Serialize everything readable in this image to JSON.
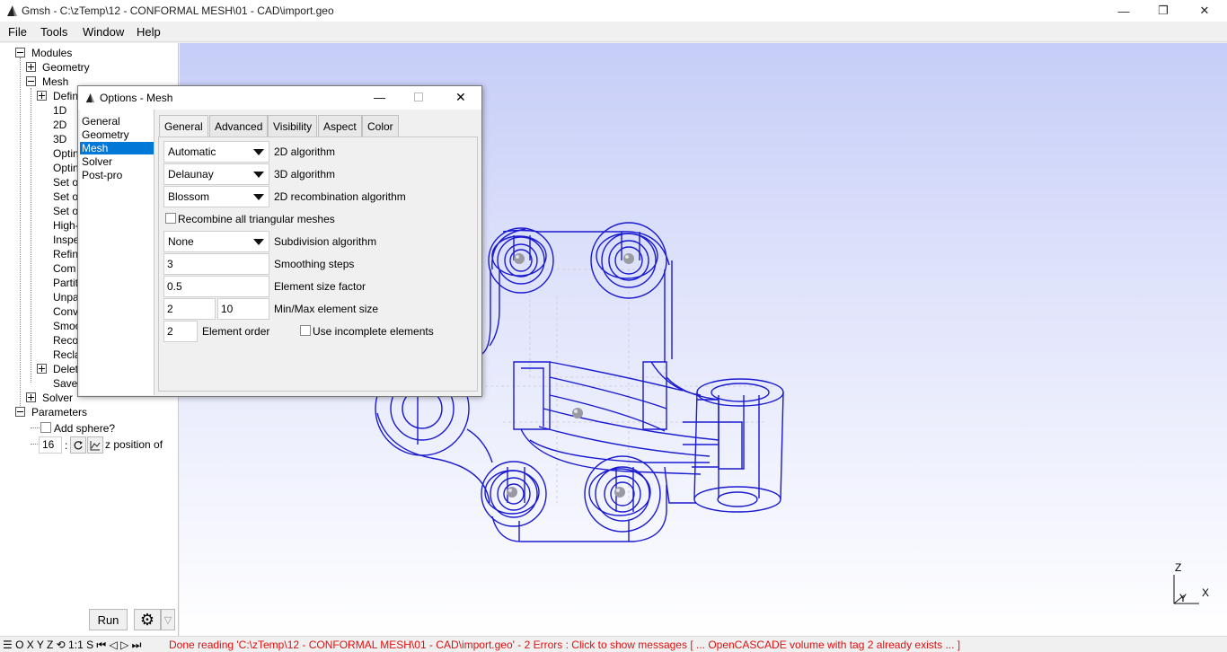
{
  "window": {
    "title": "Gmsh - C:\\zTemp\\12 - CONFORMAL MESH\\01 - CAD\\import.geo",
    "minimize": "—",
    "maximize": "❐",
    "close": "✕"
  },
  "menu": [
    "File",
    "Tools",
    "Window",
    "Help"
  ],
  "tree": {
    "modules": "Modules",
    "geometry": "Geometry",
    "mesh": "Mesh",
    "mesh_items": [
      "Defin",
      "1D",
      "2D",
      "3D",
      "Optin",
      "Optin",
      "Set o",
      "Set o",
      "Set o",
      "High-",
      "Inspe",
      "Refin",
      "Com",
      "Partit",
      "Unpa",
      "Conv",
      "Smoo",
      "Reco",
      "Recla",
      "Delet",
      "Save"
    ],
    "solver": "Solver",
    "parameters": "Parameters",
    "add_sphere": "Add sphere?",
    "z_value": "16",
    "z_sep": ":",
    "z_label": "z position of"
  },
  "bottom_left": {
    "run": "Run",
    "gear": "⚙",
    "dropdown": "▽"
  },
  "status": {
    "left": "☰ O X Y Z ⟲ 1:1 S ⏮ ◁ ▷ ⏭",
    "message": "Done reading 'C:\\zTemp\\12 - CONFORMAL MESH\\01 - CAD\\import.geo'  -  2 Errors : Click to show messages [ ... OpenCASCADE volume with tag 2 already exists ... ]"
  },
  "dialog": {
    "title": "Options - Mesh",
    "list": [
      "General",
      "Geometry",
      "Mesh",
      "Solver",
      "Post-pro"
    ],
    "selected": "Mesh",
    "tabs": [
      "General",
      "Advanced",
      "Visibility",
      "Aspect",
      "Color"
    ],
    "active_tab": "General",
    "alg2d": {
      "value": "Automatic",
      "label": "2D algorithm"
    },
    "alg3d": {
      "value": "Delaunay",
      "label": "3D algorithm"
    },
    "recomb": {
      "value": "Blossom",
      "label": "2D recombination algorithm"
    },
    "recombine_all": "Recombine all triangular meshes",
    "subdiv": {
      "value": "None",
      "label": "Subdivision algorithm"
    },
    "smoothing": {
      "value": "3",
      "label": "Smoothing steps"
    },
    "size_factor": {
      "value": "0.5",
      "label": "Element size factor"
    },
    "minmax": {
      "min": "2",
      "max": "10",
      "label": "Min/Max element size"
    },
    "order": {
      "value": "2",
      "label": "Element order"
    },
    "incomplete": "Use incomplete elements"
  },
  "axes": {
    "z": "Z",
    "y": "Y",
    "x": "X"
  },
  "colors": {
    "mesh_line": "#1a1ad0",
    "selection": "#0078d7",
    "error_text": "#e01010"
  }
}
